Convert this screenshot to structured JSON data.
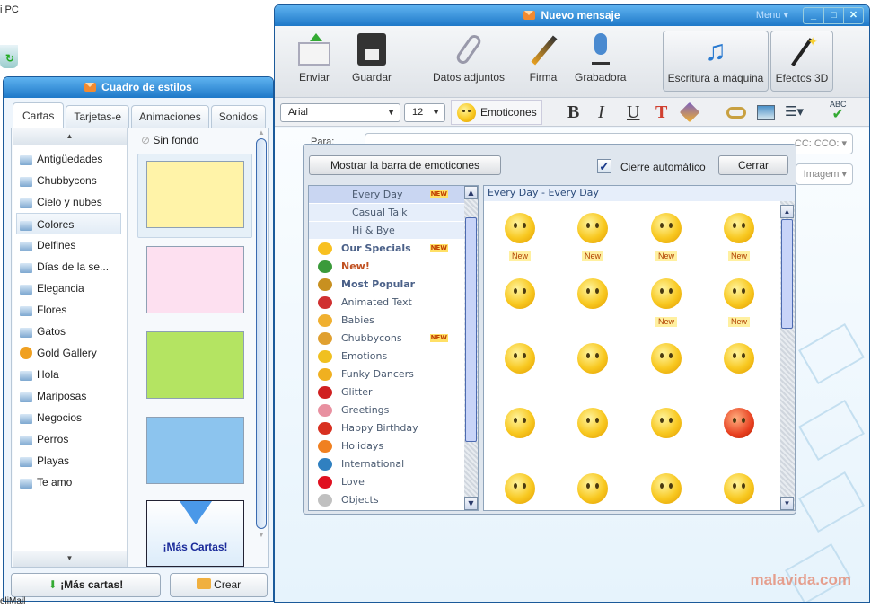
{
  "desktop": {
    "icon_label": "i PC",
    "bottom_label": "eliMail"
  },
  "compose": {
    "title": "Nuevo mensaje",
    "menu": "Menu",
    "window_buttons": [
      "_",
      "□",
      "✕"
    ],
    "toolbar": [
      {
        "label": "Enviar",
        "icon": "send-mail-icon"
      },
      {
        "label": "Guardar",
        "icon": "floppy-disk-icon"
      },
      {
        "label": "Datos adjuntos",
        "icon": "paperclip-icon"
      },
      {
        "label": "Firma",
        "icon": "pen-icon"
      },
      {
        "label": "Grabadora",
        "icon": "microphone-icon"
      },
      {
        "label": "Escritura a máquina",
        "icon": "music-notes-icon"
      },
      {
        "label": "Efectos 3D",
        "icon": "magic-wand-icon"
      }
    ],
    "format": {
      "font": "Arial",
      "size": "12",
      "emoticons_label": "Emoticones",
      "bold": "B",
      "italic": "I",
      "underline": "U",
      "color": "T",
      "spell": "ABC"
    },
    "fields": {
      "to_label": "Para:",
      "cc_label": "CC: CCO:",
      "image_label": "Imagem"
    },
    "watermark": "malavida.com"
  },
  "emoticons": {
    "show_bar_button": "Mostrar la barra de emoticones",
    "auto_close_label": "Cierre automático",
    "auto_close_checked": true,
    "close_button": "Cerrar",
    "new_tag": "NEW",
    "categories": [
      {
        "label": "Every Day",
        "sub": true,
        "active": true,
        "new": true
      },
      {
        "label": "Casual Talk",
        "sub": true
      },
      {
        "label": "Hi & Bye",
        "sub": true
      },
      {
        "label": "Our Specials",
        "style": "bold",
        "new": true,
        "color": "#f8c020"
      },
      {
        "label": "New!",
        "style": "red",
        "color": "#3a9a3a"
      },
      {
        "label": "Most Popular",
        "style": "bold",
        "color": "#c89020"
      },
      {
        "label": "Animated Text",
        "color": "#d03030"
      },
      {
        "label": "Babies",
        "color": "#f0b030"
      },
      {
        "label": "Chubbycons",
        "new": true,
        "color": "#e0a030"
      },
      {
        "label": "Emotions",
        "color": "#f0c020"
      },
      {
        "label": "Funky Dancers",
        "color": "#f0b020"
      },
      {
        "label": "Glitter",
        "color": "#d02020"
      },
      {
        "label": "Greetings",
        "color": "#e890a0"
      },
      {
        "label": "Happy Birthday",
        "color": "#d83020"
      },
      {
        "label": "Holidays",
        "color": "#f08020"
      },
      {
        "label": "International",
        "color": "#3080c0"
      },
      {
        "label": "Love",
        "color": "#e01020"
      },
      {
        "label": "Objects",
        "color": "#c0c0c0"
      }
    ],
    "grid_header": "Every Day - Every Day",
    "new_label": "New",
    "grid_new_flags": [
      true,
      true,
      true,
      true,
      false,
      false,
      true,
      true,
      false,
      false,
      false,
      false,
      false,
      false,
      false,
      false,
      false,
      false,
      false,
      false
    ]
  },
  "styles": {
    "title": "Cuadro de estilos",
    "tabs": [
      "Cartas",
      "Tarjetas-e",
      "Animaciones",
      "Sonidos"
    ],
    "active_tab": "Cartas",
    "categories": [
      "Antigüedades",
      "Chubbycons",
      "Cielo y nubes",
      "Colores",
      "Delfines",
      "Días de la se...",
      "Elegancia",
      "Flores",
      "Gatos",
      "Gold Gallery",
      "Hola",
      "Mariposas",
      "Negocios",
      "Perros",
      "Playas",
      "Te amo"
    ],
    "active_category": "Colores",
    "no_background": "Sin fondo",
    "cards": [
      "#fff3a8",
      "#fde0f0",
      "#b4e462",
      "#8cc4ee"
    ],
    "more_cards_card": "¡Más Cartas!",
    "more_cards_button": "¡Más cartas!",
    "create_button": "Crear"
  }
}
